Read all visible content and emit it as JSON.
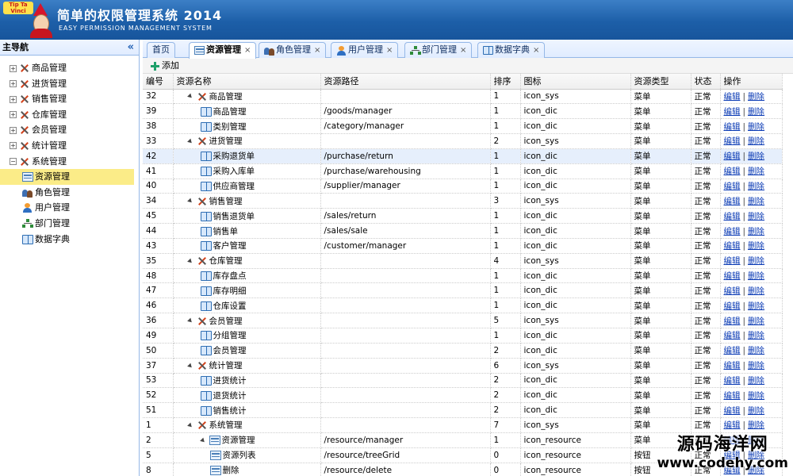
{
  "header": {
    "title": "简单的权限管理系统 2014",
    "subtitle": "EASY PERMISSION MANAGEMENT SYSTEM",
    "logo_text": "Tip Ta Vinci"
  },
  "sidebar": {
    "title": "主导航",
    "collapse_glyph": "«",
    "items": [
      {
        "label": "商品管理",
        "expand": "+"
      },
      {
        "label": "进货管理",
        "expand": "+"
      },
      {
        "label": "销售管理",
        "expand": "+"
      },
      {
        "label": "仓库管理",
        "expand": "+"
      },
      {
        "label": "会员管理",
        "expand": "+"
      },
      {
        "label": "统计管理",
        "expand": "+"
      },
      {
        "label": "系统管理",
        "expand": "−"
      }
    ],
    "children": [
      {
        "label": "资源管理",
        "icon": "resource-icon",
        "selected": true
      },
      {
        "label": "角色管理",
        "icon": "role-icon"
      },
      {
        "label": "用户管理",
        "icon": "user-icon"
      },
      {
        "label": "部门管理",
        "icon": "dept-icon"
      },
      {
        "label": "数据字典",
        "icon": "dict-icon"
      }
    ]
  },
  "tabs": [
    {
      "label": "首页"
    },
    {
      "label": "资源管理",
      "active": true
    },
    {
      "label": "角色管理"
    },
    {
      "label": "用户管理"
    },
    {
      "label": "部门管理"
    },
    {
      "label": "数据字典"
    }
  ],
  "tab_close": "×",
  "toolbar": {
    "add_label": "添加"
  },
  "grid": {
    "columns": [
      "编号",
      "资源名称",
      "资源路径",
      "排序",
      "图标",
      "资源类型",
      "状态",
      "操作"
    ],
    "edit_label": "编辑",
    "delete_label": "删除",
    "op_separator": "|",
    "rows": [
      {
        "id": "32",
        "name": "商品管理",
        "path": "",
        "sort": "1",
        "icon": "icon_sys",
        "type": "菜单",
        "status": "正常",
        "level": 0
      },
      {
        "id": "39",
        "name": "商品管理",
        "path": "/goods/manager",
        "sort": "1",
        "icon": "icon_dic",
        "type": "菜单",
        "status": "正常",
        "level": 1
      },
      {
        "id": "38",
        "name": "类别管理",
        "path": "/category/manager",
        "sort": "1",
        "icon": "icon_dic",
        "type": "菜单",
        "status": "正常",
        "level": 1
      },
      {
        "id": "33",
        "name": "进货管理",
        "path": "",
        "sort": "2",
        "icon": "icon_sys",
        "type": "菜单",
        "status": "正常",
        "level": 0
      },
      {
        "id": "42",
        "name": "采购退货单",
        "path": "/purchase/return",
        "sort": "1",
        "icon": "icon_dic",
        "type": "菜单",
        "status": "正常",
        "level": 1,
        "highlight": true
      },
      {
        "id": "41",
        "name": "采购入库单",
        "path": "/purchase/warehousing",
        "sort": "1",
        "icon": "icon_dic",
        "type": "菜单",
        "status": "正常",
        "level": 1
      },
      {
        "id": "40",
        "name": "供应商管理",
        "path": "/supplier/manager",
        "sort": "1",
        "icon": "icon_dic",
        "type": "菜单",
        "status": "正常",
        "level": 1
      },
      {
        "id": "34",
        "name": "销售管理",
        "path": "",
        "sort": "3",
        "icon": "icon_sys",
        "type": "菜单",
        "status": "正常",
        "level": 0
      },
      {
        "id": "45",
        "name": "销售退货单",
        "path": "/sales/return",
        "sort": "1",
        "icon": "icon_dic",
        "type": "菜单",
        "status": "正常",
        "level": 1
      },
      {
        "id": "44",
        "name": "销售单",
        "path": "/sales/sale",
        "sort": "1",
        "icon": "icon_dic",
        "type": "菜单",
        "status": "正常",
        "level": 1
      },
      {
        "id": "43",
        "name": "客户管理",
        "path": "/customer/manager",
        "sort": "1",
        "icon": "icon_dic",
        "type": "菜单",
        "status": "正常",
        "level": 1
      },
      {
        "id": "35",
        "name": "仓库管理",
        "path": "",
        "sort": "4",
        "icon": "icon_sys",
        "type": "菜单",
        "status": "正常",
        "level": 0
      },
      {
        "id": "48",
        "name": "库存盘点",
        "path": "",
        "sort": "1",
        "icon": "icon_dic",
        "type": "菜单",
        "status": "正常",
        "level": 1
      },
      {
        "id": "47",
        "name": "库存明细",
        "path": "",
        "sort": "1",
        "icon": "icon_dic",
        "type": "菜单",
        "status": "正常",
        "level": 1
      },
      {
        "id": "46",
        "name": "仓库设置",
        "path": "",
        "sort": "1",
        "icon": "icon_dic",
        "type": "菜单",
        "status": "正常",
        "level": 1
      },
      {
        "id": "36",
        "name": "会员管理",
        "path": "",
        "sort": "5",
        "icon": "icon_sys",
        "type": "菜单",
        "status": "正常",
        "level": 0
      },
      {
        "id": "49",
        "name": "分组管理",
        "path": "",
        "sort": "1",
        "icon": "icon_dic",
        "type": "菜单",
        "status": "正常",
        "level": 1
      },
      {
        "id": "50",
        "name": "会员管理",
        "path": "",
        "sort": "2",
        "icon": "icon_dic",
        "type": "菜单",
        "status": "正常",
        "level": 1
      },
      {
        "id": "37",
        "name": "统计管理",
        "path": "",
        "sort": "6",
        "icon": "icon_sys",
        "type": "菜单",
        "status": "正常",
        "level": 0
      },
      {
        "id": "53",
        "name": "进货统计",
        "path": "",
        "sort": "2",
        "icon": "icon_dic",
        "type": "菜单",
        "status": "正常",
        "level": 1
      },
      {
        "id": "52",
        "name": "退货统计",
        "path": "",
        "sort": "2",
        "icon": "icon_dic",
        "type": "菜单",
        "status": "正常",
        "level": 1
      },
      {
        "id": "51",
        "name": "销售统计",
        "path": "",
        "sort": "2",
        "icon": "icon_dic",
        "type": "菜单",
        "status": "正常",
        "level": 1
      },
      {
        "id": "1",
        "name": "系统管理",
        "path": "",
        "sort": "7",
        "icon": "icon_sys",
        "type": "菜单",
        "status": "正常",
        "level": 0
      },
      {
        "id": "2",
        "name": "资源管理",
        "path": "/resource/manager",
        "sort": "1",
        "icon": "icon_resource",
        "type": "菜单",
        "status": "正常",
        "level": 2
      },
      {
        "id": "5",
        "name": "资源列表",
        "path": "/resource/treeGrid",
        "sort": "0",
        "icon": "icon_resource",
        "type": "按钮",
        "status": "正常",
        "level": 3
      },
      {
        "id": "8",
        "name": "删除",
        "path": "/resource/delete",
        "sort": "0",
        "icon": "icon_resource",
        "type": "按钮",
        "status": "正常",
        "level": 3
      }
    ]
  },
  "watermark": {
    "line1": "源码海洋网",
    "line2": "www.codehy.com"
  },
  "colors": {
    "header_blue": "#1d5fa8",
    "border_blue": "#95b8e7",
    "selected_yellow": "#fbec88",
    "row_highlight": "#e6effc",
    "link_blue": "#0b3bb5"
  }
}
